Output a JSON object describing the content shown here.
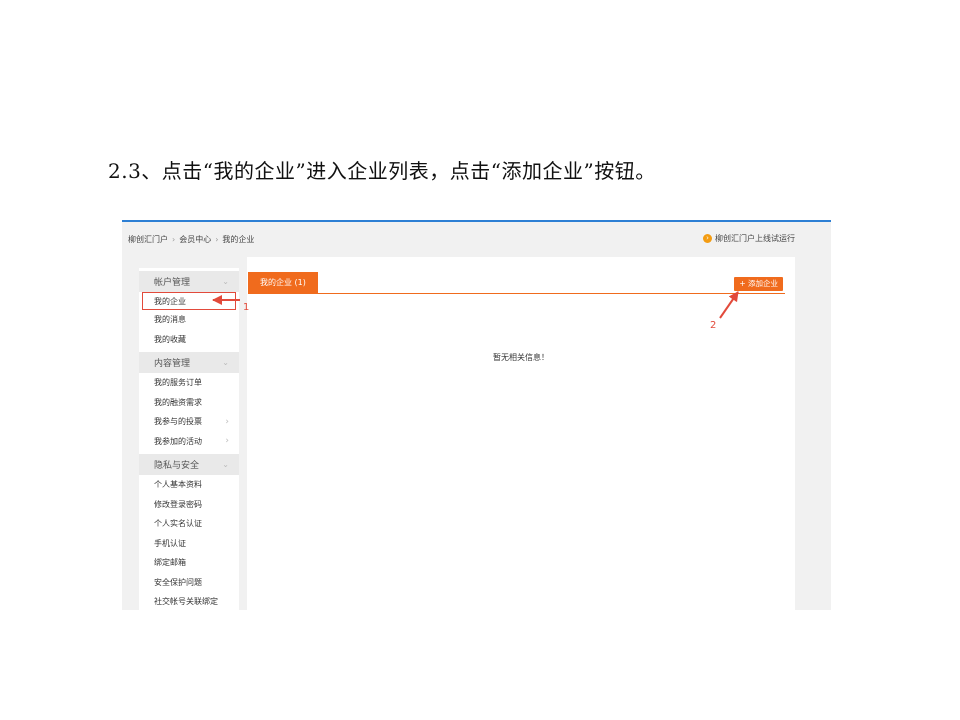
{
  "caption": "2.3、点击“我的企业”进入企业列表，点击“添加企业”按钮。",
  "breadcrumb": {
    "items": [
      "柳创汇门户",
      "会员中心",
      "我的企业"
    ],
    "separator": "›"
  },
  "top_right": {
    "icon": "info-icon",
    "text": "柳创汇门户上线试运行"
  },
  "sidebar": {
    "groups": [
      {
        "title": "帐户管理",
        "items": [
          {
            "label": "我的企业",
            "active": true
          },
          {
            "label": "我的消息"
          },
          {
            "label": "我的收藏"
          }
        ]
      },
      {
        "title": "内容管理",
        "items": [
          {
            "label": "我的服务订单"
          },
          {
            "label": "我的融资需求"
          },
          {
            "label": "我参与的投票"
          },
          {
            "label": "我参加的活动"
          }
        ]
      },
      {
        "title": "隐私与安全",
        "items": [
          {
            "label": "个人基本资料"
          },
          {
            "label": "修改登录密码"
          },
          {
            "label": "个人实名认证"
          },
          {
            "label": "手机认证"
          },
          {
            "label": "绑定邮箱"
          },
          {
            "label": "安全保护问题"
          },
          {
            "label": "社交帐号关联绑定"
          }
        ]
      }
    ]
  },
  "main": {
    "tab_label": "我的企业 (1)",
    "add_button": "+ 添加企业",
    "empty_message": "暂无相关信息！"
  },
  "annotations": {
    "label_1": "1",
    "label_2": "2",
    "color": "#e24a3b"
  },
  "colors": {
    "accent": "#f06b1d",
    "top_border": "#2d7fd4",
    "highlight": "#e24a3b"
  }
}
